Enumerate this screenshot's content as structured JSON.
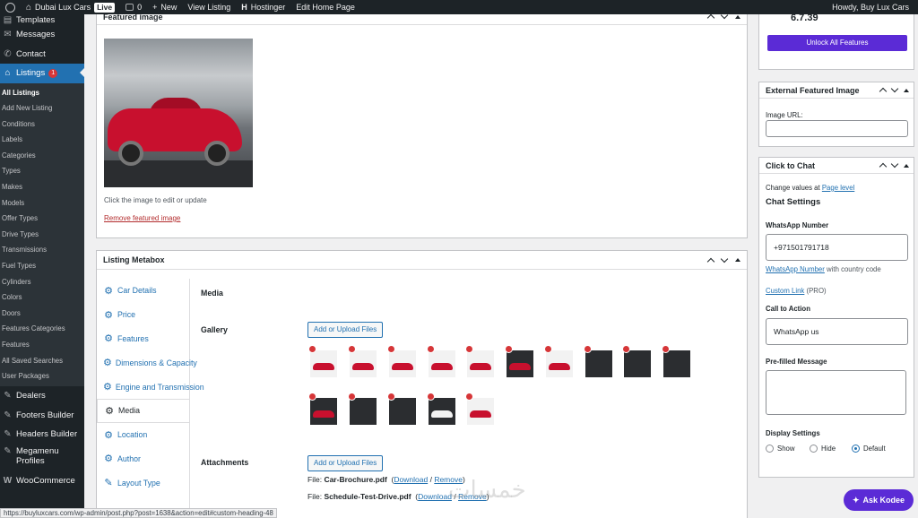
{
  "adminbar": {
    "site_name": "Dubai Lux Cars",
    "live_badge": "Live",
    "comments_count": "0",
    "new_label": "New",
    "view_listing": "View Listing",
    "hostinger": "Hostinger",
    "edit_home": "Edit Home Page",
    "howdy": "Howdy, Buy Lux Cars"
  },
  "sidebar": {
    "top_items": [
      {
        "label": "Templates",
        "icon": "templates-icon"
      },
      {
        "label": "Messages",
        "icon": "messages-icon"
      },
      {
        "label": "Contact",
        "icon": "contact-icon"
      }
    ],
    "listings": {
      "label": "Listings",
      "badge": "1"
    },
    "submenu": [
      "All Listings",
      "Add New Listing",
      "Conditions",
      "Labels",
      "Categories",
      "Types",
      "Makes",
      "Models",
      "Offer Types",
      "Drive Types",
      "Transmissions",
      "Fuel Types",
      "Cylinders",
      "Colors",
      "Doors",
      "Features Categories",
      "Features",
      "All Saved Searches",
      "User Packages"
    ],
    "bottom_items": [
      "Dealers",
      "Footers Builder",
      "Headers Builder",
      "Megamenu Profiles",
      "WooCommerce"
    ]
  },
  "featured_image": {
    "title": "Featured image",
    "hint": "Click the image to edit or update",
    "remove_link": "Remove featured image"
  },
  "listing_metabox": {
    "title": "Listing Metabox",
    "tabs": [
      "Car Details",
      "Price",
      "Features",
      "Dimensions & Capacity",
      "Engine and Transmission",
      "Media",
      "Location",
      "Author",
      "Layout Type"
    ],
    "active_tab": "Media",
    "section_title": "Media",
    "gallery_label": "Gallery",
    "attachments_label": "Attachments",
    "upload_button": "Add or Upload Files",
    "files": [
      {
        "prefix": "File:",
        "name": "Car-Brochure.pdf",
        "download": "Download",
        "sep": "/",
        "remove": "Remove"
      },
      {
        "prefix": "File:",
        "name": "Schedule-Test-Drive.pdf",
        "download": "Download",
        "sep": "/",
        "remove": "Remove"
      }
    ]
  },
  "right": {
    "price_partial": "6.7.39",
    "unlock_button": "Unlock All Features",
    "external_featured_image": {
      "title": "External Featured Image",
      "image_url_label": "Image URL:"
    },
    "click_to_chat": {
      "title": "Click to Chat",
      "change_values": "Change values at ",
      "page_level": "Page level",
      "chat_settings": "Chat Settings",
      "whatsapp_label": "WhatsApp Number",
      "whatsapp_value": "+971501791718",
      "whatsapp_hint_link": "WhatsApp Number",
      "whatsapp_hint_rest": " with country code",
      "custom_link": "Custom Link",
      "custom_link_pro": " (PRO)",
      "cta_label": "Call to Action",
      "cta_value": "WhatsApp us",
      "prefilled_label": "Pre-filled Message",
      "display_label": "Display Settings",
      "display_options": [
        "Show",
        "Hide",
        "Default"
      ],
      "display_selected": "Default"
    }
  },
  "statusbar_url": "https://buyluxcars.com/wp-admin/post.php?post=1638&action=edit#custom-heading-48",
  "ask_kodee": "Ask Kodee",
  "watermark": "خمسات"
}
